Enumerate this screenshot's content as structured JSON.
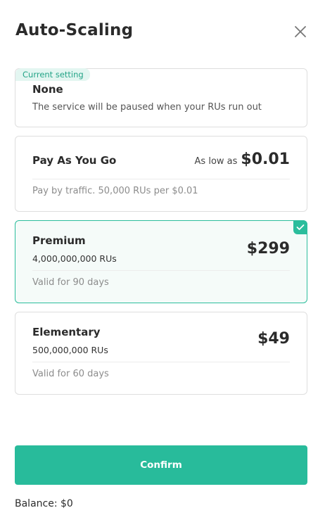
{
  "header": {
    "title": "Auto-Scaling",
    "close_icon": "close-icon"
  },
  "options": [
    {
      "badge": "Current setting",
      "name": "None",
      "description": "The service will be paused when your RUs run out",
      "selected": false
    },
    {
      "name": "Pay As You Go",
      "price_prefix": "As low as",
      "price": "$0.01",
      "note": "Pay by traffic. 50,000 RUs per $0.01",
      "selected": false
    },
    {
      "name": "Premium",
      "rus": "4,000,000,000 RUs",
      "price": "$299",
      "validity": "Valid for 90 days",
      "selected": true
    },
    {
      "name": "Elementary",
      "rus": "500,000,000 RUs",
      "price": "$49",
      "validity": "Valid for 60 days",
      "selected": false
    }
  ],
  "footer": {
    "confirm_label": "Confirm",
    "balance": "Balance: $0"
  },
  "colors": {
    "accent": "#28bb9b",
    "badge_bg": "#e3f6f1",
    "selected_bg": "#f5fbf9"
  }
}
